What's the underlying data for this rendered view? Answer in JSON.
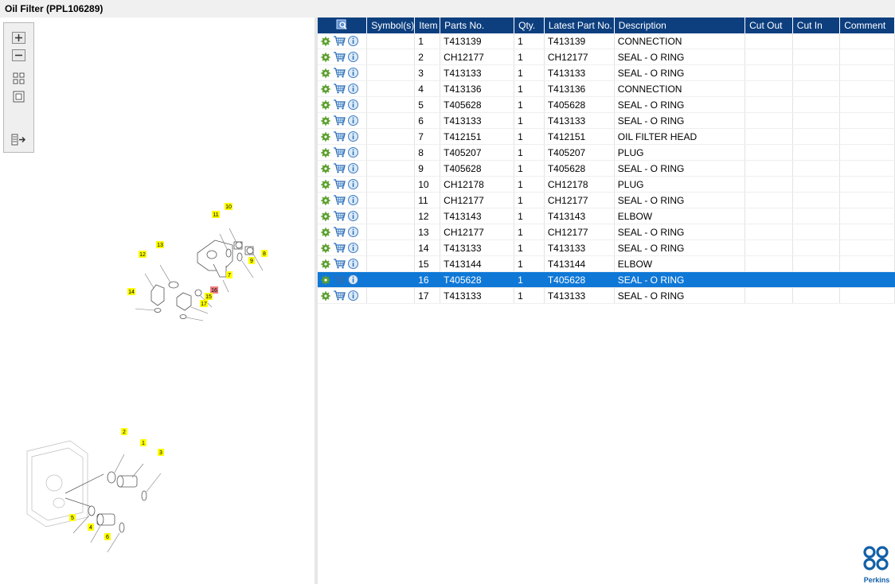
{
  "window": {
    "title": "Oil Filter (PPL106289)"
  },
  "toolbar": {
    "buttons": [
      {
        "name": "zoom-in-button",
        "icon": "plus-icon"
      },
      {
        "name": "zoom-out-button",
        "icon": "minus-icon"
      },
      {
        "name": "fit-view-button",
        "icon": "grid-icon"
      },
      {
        "name": "single-view-button",
        "icon": "square-icon"
      },
      {
        "name": "export-button",
        "icon": "export-icon"
      }
    ]
  },
  "diagram": {
    "callouts_top": [
      "10",
      "11",
      "13",
      "12",
      "9",
      "8",
      "7",
      "14",
      "16",
      "15",
      "17"
    ],
    "callouts_bottom": [
      "2",
      "1",
      "3",
      "5",
      "4",
      "6"
    ],
    "highlighted": "16"
  },
  "table": {
    "columns": [
      "",
      "Symbol(s)",
      "Item",
      "Parts No.",
      "Qty.",
      "Latest Part No.",
      "Description",
      "Cut Out",
      "Cut In",
      "Comment"
    ],
    "rows": [
      {
        "item": "1",
        "part": "T413139",
        "qty": "1",
        "latest": "T413139",
        "desc": "CONNECTION"
      },
      {
        "item": "2",
        "part": "CH12177",
        "qty": "1",
        "latest": "CH12177",
        "desc": "SEAL - O RING"
      },
      {
        "item": "3",
        "part": "T413133",
        "qty": "1",
        "latest": "T413133",
        "desc": "SEAL - O RING"
      },
      {
        "item": "4",
        "part": "T413136",
        "qty": "1",
        "latest": "T413136",
        "desc": "CONNECTION"
      },
      {
        "item": "5",
        "part": "T405628",
        "qty": "1",
        "latest": "T405628",
        "desc": "SEAL - O RING"
      },
      {
        "item": "6",
        "part": "T413133",
        "qty": "1",
        "latest": "T413133",
        "desc": "SEAL - O RING"
      },
      {
        "item": "7",
        "part": "T412151",
        "qty": "1",
        "latest": "T412151",
        "desc": "OIL FILTER HEAD"
      },
      {
        "item": "8",
        "part": "T405207",
        "qty": "1",
        "latest": "T405207",
        "desc": "PLUG"
      },
      {
        "item": "9",
        "part": "T405628",
        "qty": "1",
        "latest": "T405628",
        "desc": "SEAL - O RING"
      },
      {
        "item": "10",
        "part": "CH12178",
        "qty": "1",
        "latest": "CH12178",
        "desc": "PLUG"
      },
      {
        "item": "11",
        "part": "CH12177",
        "qty": "1",
        "latest": "CH12177",
        "desc": "SEAL - O RING"
      },
      {
        "item": "12",
        "part": "T413143",
        "qty": "1",
        "latest": "T413143",
        "desc": "ELBOW"
      },
      {
        "item": "13",
        "part": "CH12177",
        "qty": "1",
        "latest": "CH12177",
        "desc": "SEAL - O RING"
      },
      {
        "item": "14",
        "part": "T413133",
        "qty": "1",
        "latest": "T413133",
        "desc": "SEAL - O RING"
      },
      {
        "item": "15",
        "part": "T413144",
        "qty": "1",
        "latest": "T413144",
        "desc": "ELBOW"
      },
      {
        "item": "16",
        "part": "T405628",
        "qty": "1",
        "latest": "T405628",
        "desc": "SEAL - O RING",
        "selected": true
      },
      {
        "item": "17",
        "part": "T413133",
        "qty": "1",
        "latest": "T413133",
        "desc": "SEAL - O RING"
      }
    ]
  },
  "brand": {
    "name": "Perkins",
    "color": "#1260a8"
  },
  "colors": {
    "header": "#0d3f7f",
    "selected": "#0f78d7",
    "callout": "#ffff00",
    "callout_highlight": "#f08080",
    "gear": "#5aa02c"
  }
}
